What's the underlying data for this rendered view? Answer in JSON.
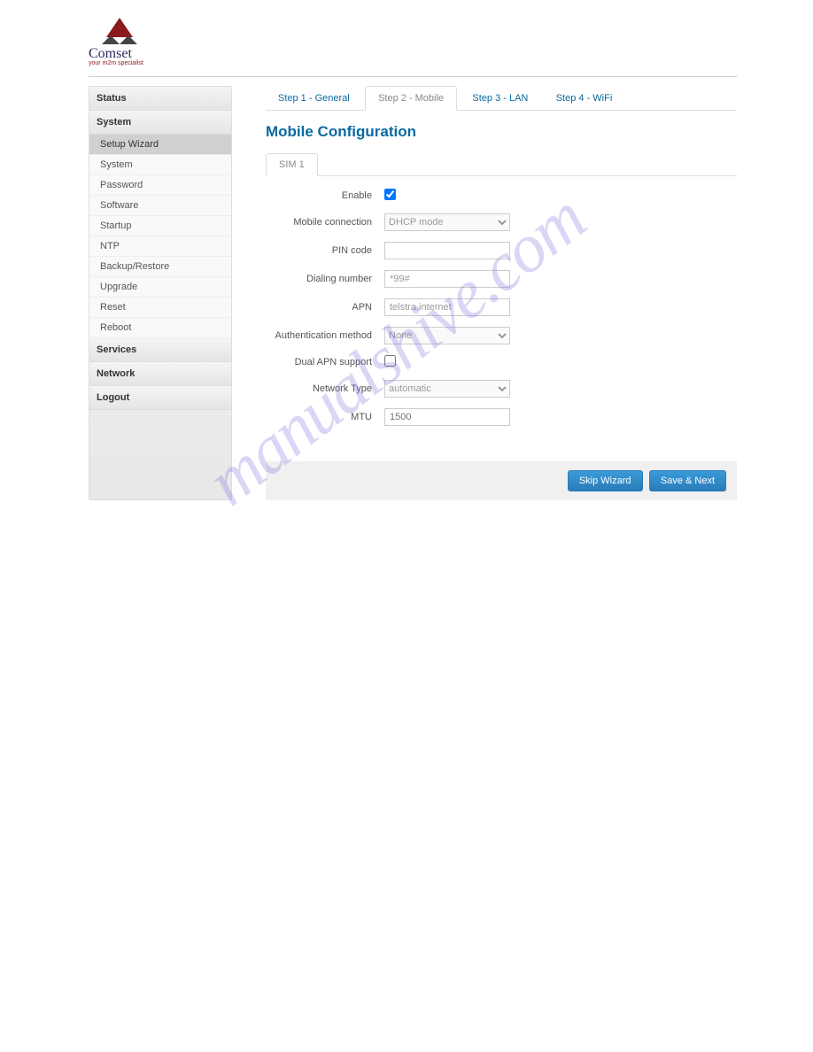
{
  "logo": {
    "name": "Comset",
    "tagline": "your m2m specialist"
  },
  "sidebar": {
    "sections": [
      {
        "label": "Status"
      },
      {
        "label": "System"
      },
      {
        "label": "Services"
      },
      {
        "label": "Network"
      },
      {
        "label": "Logout"
      }
    ],
    "system_items": [
      {
        "label": "Setup Wizard",
        "active": true
      },
      {
        "label": "System"
      },
      {
        "label": "Password"
      },
      {
        "label": "Software"
      },
      {
        "label": "Startup"
      },
      {
        "label": "NTP"
      },
      {
        "label": "Backup/Restore"
      },
      {
        "label": "Upgrade"
      },
      {
        "label": "Reset"
      },
      {
        "label": "Reboot"
      }
    ]
  },
  "steps": [
    {
      "label": "Step 1 - General"
    },
    {
      "label": "Step 2 - Mobile",
      "active": true
    },
    {
      "label": "Step 3 - LAN"
    },
    {
      "label": "Step 4 - WiFi"
    }
  ],
  "title": "Mobile Configuration",
  "subtab": "SIM 1",
  "form": {
    "enable_label": "Enable",
    "enable_checked": true,
    "mobile_connection_label": "Mobile connection",
    "mobile_connection_value": "DHCP mode",
    "pin_code_label": "PIN code",
    "pin_code_value": "",
    "dialing_number_label": "Dialing number",
    "dialing_number_value": "*99#",
    "apn_label": "APN",
    "apn_value": "telstra.internet",
    "auth_method_label": "Authentication method",
    "auth_method_value": "None",
    "dual_apn_label": "Dual APN support",
    "dual_apn_checked": false,
    "network_type_label": "Network Type",
    "network_type_value": "automatic",
    "mtu_label": "MTU",
    "mtu_placeholder": "1500"
  },
  "buttons": {
    "skip": "Skip Wizard",
    "save": "Save & Next"
  },
  "watermark": "manualshive.com"
}
